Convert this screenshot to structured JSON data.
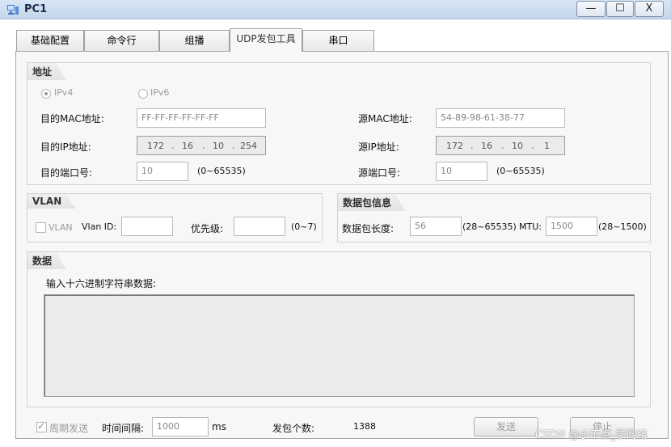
{
  "window": {
    "title": "PC1",
    "minimize": "—",
    "maximize": "☐",
    "close": "X"
  },
  "tabs": [
    "基础配置",
    "命令行",
    "组播",
    "UDP发包工具",
    "串口"
  ],
  "address": {
    "group_title": "地址",
    "ipv4_label": "IPv4",
    "ipv6_label": "IPv6",
    "dst_mac_label": "目的MAC地址:",
    "dst_mac_value": "FF-FF-FF-FF-FF-FF",
    "src_mac_label": "源MAC地址:",
    "src_mac_value": "54-89-98-61-38-77",
    "dst_ip_label": "目的IP地址:",
    "dst_ip": [
      "172",
      "16",
      "10",
      "254"
    ],
    "src_ip_label": "源IP地址:",
    "src_ip": [
      "172",
      "16",
      "10",
      "1"
    ],
    "ip_sep": ".",
    "dst_port_label": "目的端口号:",
    "dst_port_value": "10",
    "dst_port_range": "(0~65535)",
    "src_port_label": "源端口号:",
    "src_port_value": "10",
    "src_port_range": "(0~65535)"
  },
  "vlan": {
    "group_title": "VLAN",
    "checkbox_label": "VLAN",
    "vlan_id_label": "Vlan ID:",
    "vlan_id_value": "",
    "priority_label": "优先级:",
    "priority_value": "",
    "priority_range": "(0~7)"
  },
  "packet_info": {
    "group_title": "数据包信息",
    "length_label": "数据包长度:",
    "length_value": "56",
    "length_range": "(28~65535)",
    "mtu_label": "MTU:",
    "mtu_value": "1500",
    "mtu_range": "(28~1500)"
  },
  "data": {
    "group_title": "数据",
    "hex_label": "输入十六进制字符串数据:",
    "hex_value": ""
  },
  "footer": {
    "periodic_label": "周期发送",
    "interval_label": "时间间隔:",
    "interval_value": "1000",
    "interval_unit": "ms",
    "count_label": "发包个数:",
    "count_value": "1388",
    "send_label": "发送",
    "stop_label": "停止"
  },
  "watermark": "CSDN @小不点_学网络"
}
